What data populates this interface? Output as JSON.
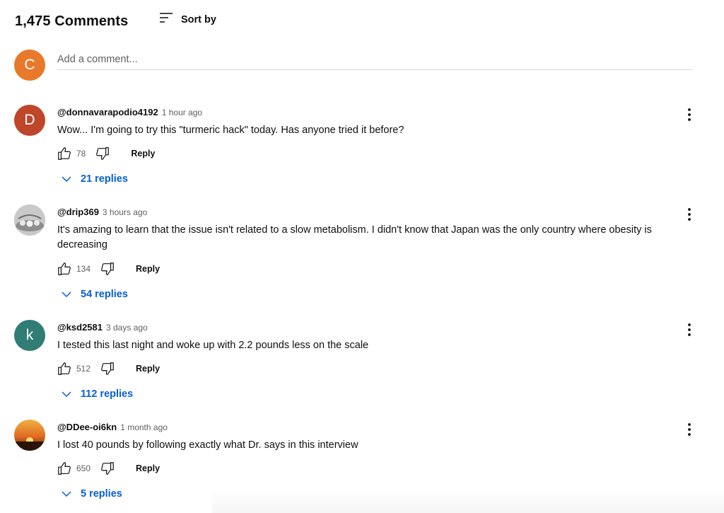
{
  "header": {
    "comment_count": "1,475 Comments",
    "sort_label": "Sort by",
    "sort_icon": "sort-icon"
  },
  "add_comment": {
    "avatar_letter": "C",
    "avatar_color": "#e8792b",
    "placeholder": "Add a comment..."
  },
  "colors": {
    "link_blue": "#065fd4",
    "secondary_text": "#606060"
  },
  "comments": [
    {
      "author": "@donnavarapodio4192",
      "time": "1 hour ago",
      "text": "Wow... I'm going to try this \"turmeric hack\" today. Has anyone tried it before?",
      "likes": "78",
      "reply_label": "Reply",
      "replies": "21 replies",
      "avatar_letter": "D",
      "avatar_color": "#c0462a"
    },
    {
      "author": "@drip369",
      "time": "3 hours ago",
      "text": "It's amazing to learn that the issue isn't related to a slow metabolism. I didn't know that Japan was the only country where obesity is decreasing",
      "likes": "134",
      "reply_label": "Reply",
      "replies": "54 replies",
      "avatar_letter": "",
      "avatar_color": "#9a9a9a"
    },
    {
      "author": "@ksd2581",
      "time": "3 days ago",
      "text": "I tested this last night and woke up with 2.2 pounds less on the scale",
      "likes": "512",
      "reply_label": "Reply",
      "replies": "112 replies",
      "avatar_letter": "k",
      "avatar_color": "#2f7d75"
    },
    {
      "author": "@DDee-oi6kn",
      "time": "1 month ago",
      "text": "I lost 40 pounds by following exactly what Dr. says in this interview",
      "likes": "650",
      "reply_label": "Reply",
      "replies": "5 replies",
      "avatar_letter": "",
      "avatar_color": "#d9822b"
    }
  ]
}
